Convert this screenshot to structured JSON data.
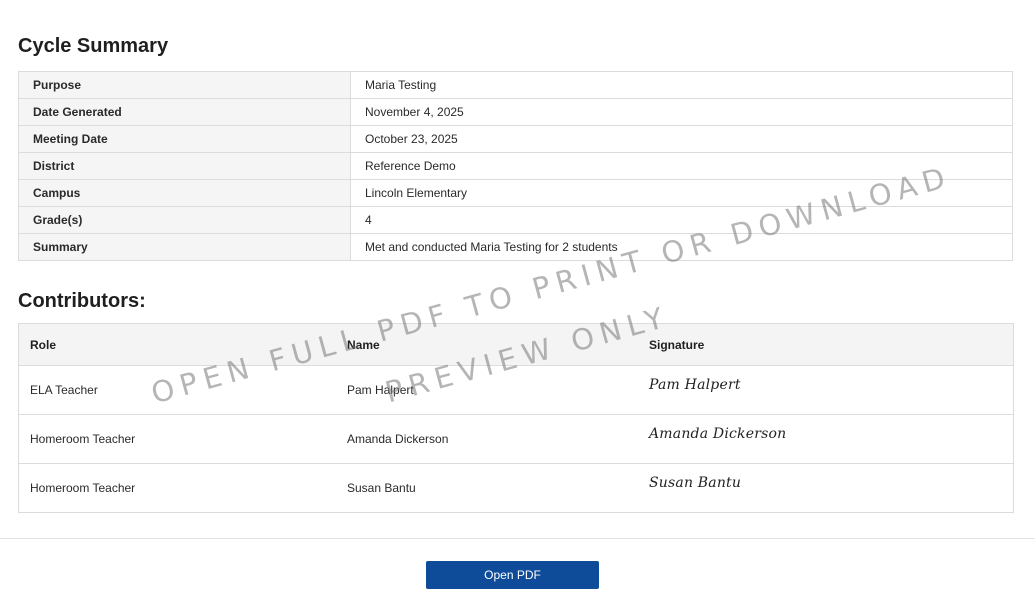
{
  "cycle_summary": {
    "title": "Cycle Summary",
    "rows": [
      {
        "label": "Purpose",
        "value": "Maria Testing"
      },
      {
        "label": "Date Generated",
        "value": "November 4, 2025"
      },
      {
        "label": "Meeting Date",
        "value": "October 23, 2025"
      },
      {
        "label": "District",
        "value": "Reference Demo"
      },
      {
        "label": "Campus",
        "value": "Lincoln Elementary"
      },
      {
        "label": "Grade(s)",
        "value": "4"
      },
      {
        "label": "Summary",
        "value": "Met and conducted Maria Testing for 2 students"
      }
    ]
  },
  "contributors": {
    "title": "Contributors:",
    "headers": {
      "role": "Role",
      "name": "Name",
      "signature": "Signature"
    },
    "rows": [
      {
        "role": "ELA Teacher",
        "name": "Pam Halpert",
        "signature": "Pam Halpert"
      },
      {
        "role": "Homeroom Teacher",
        "name": "Amanda Dickerson",
        "signature": "Amanda Dickerson"
      },
      {
        "role": "Homeroom Teacher",
        "name": "Susan Bantu",
        "signature": "Susan Bantu"
      }
    ]
  },
  "watermark": {
    "line1": "OPEN FULL PDF TO PRINT OR DOWNLOAD",
    "line2": "PREVIEW ONLY"
  },
  "footer": {
    "open_pdf_label": "Open PDF",
    "button_color": "#0e4c9a"
  }
}
